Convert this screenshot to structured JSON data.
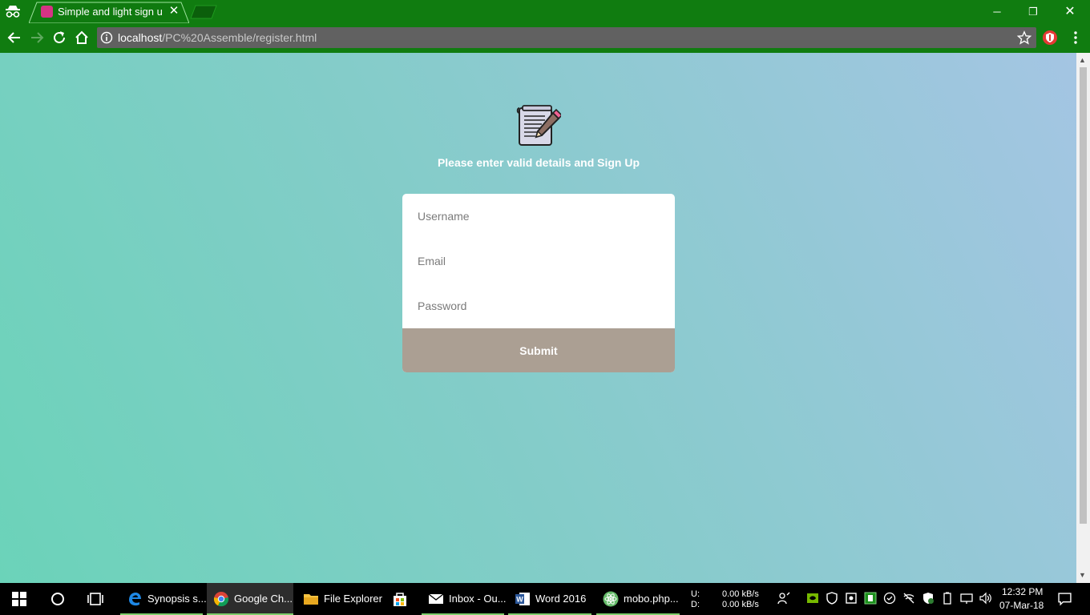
{
  "browser": {
    "tab_title": "Simple and light sign up",
    "url_host": "localhost",
    "url_path": "/PC%20Assemble/register.html",
    "accent_color": "#107c10"
  },
  "page": {
    "subtitle": "Please enter valid details and Sign Up",
    "form": {
      "username_placeholder": "Username",
      "email_placeholder": "Email",
      "password_placeholder": "Password",
      "submit_label": "Submit"
    },
    "colors": {
      "gradient_start": "#6bd3b9",
      "gradient_end": "#a4c5e3",
      "submit_bg": "#ab9f93"
    }
  },
  "taskbar": {
    "items": [
      {
        "label": "Synopsis s...",
        "icon": "edge-icon"
      },
      {
        "label": "Google Ch...",
        "icon": "chrome-icon"
      },
      {
        "label": "File Explorer",
        "icon": "folder-icon"
      },
      {
        "label": "",
        "icon": "store-icon"
      },
      {
        "label": "Inbox - Ou...",
        "icon": "mail-icon"
      },
      {
        "label": "Word 2016",
        "icon": "word-icon"
      },
      {
        "label": "mobo.php...",
        "icon": "atom-icon"
      }
    ],
    "net_up_label": "U:",
    "net_down_label": "D:",
    "net_up_value": "0.00 kB/s",
    "net_down_value": "0.00 kB/s",
    "time": "12:32 PM",
    "date": "07-Mar-18"
  }
}
